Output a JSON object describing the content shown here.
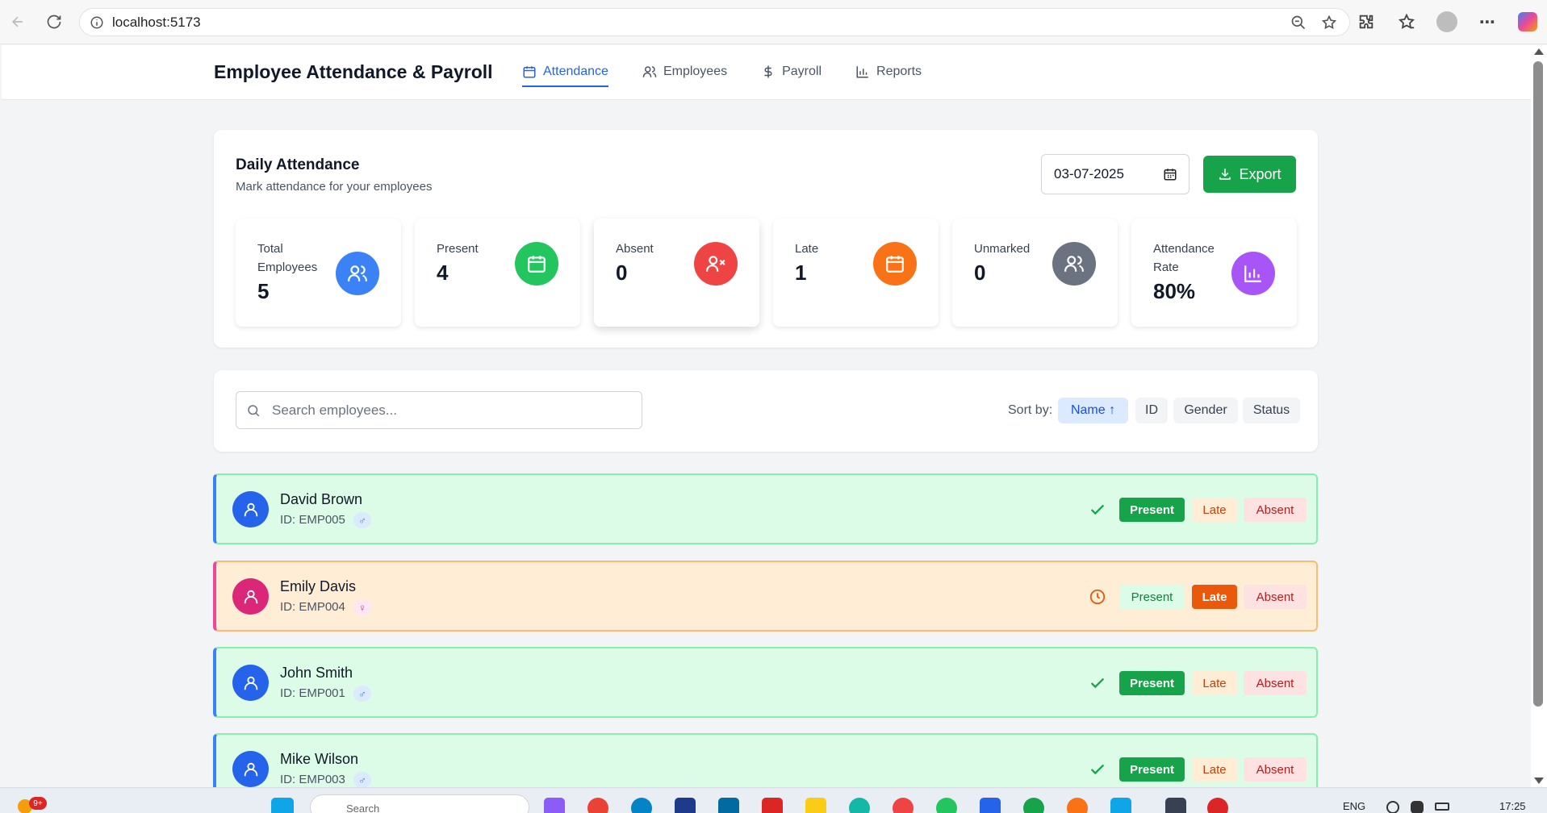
{
  "browser": {
    "url": "localhost:5173"
  },
  "header": {
    "title": "Employee Attendance & Payroll",
    "tabs": [
      {
        "label": "Attendance",
        "icon": "calendar-icon",
        "active": true
      },
      {
        "label": "Employees",
        "icon": "users-icon",
        "active": false
      },
      {
        "label": "Payroll",
        "icon": "dollar-icon",
        "active": false
      },
      {
        "label": "Reports",
        "icon": "bar-chart-icon",
        "active": false
      }
    ]
  },
  "attendance": {
    "title": "Daily Attendance",
    "subtitle": "Mark attendance for your employees",
    "date": "03-07-2025",
    "export_label": "Export"
  },
  "stats": [
    {
      "label": "Total Employees",
      "value": "5",
      "icon": "users-icon",
      "color": "#3b82f6"
    },
    {
      "label": "Present",
      "value": "4",
      "icon": "calendar-icon",
      "color": "#22c55e"
    },
    {
      "label": "Absent",
      "value": "0",
      "icon": "user-x-icon",
      "color": "#ef4444"
    },
    {
      "label": "Late",
      "value": "1",
      "icon": "calendar-icon",
      "color": "#f97316"
    },
    {
      "label": "Unmarked",
      "value": "0",
      "icon": "users-icon",
      "color": "#6b7280"
    },
    {
      "label": "Attendance Rate",
      "value": "80%",
      "icon": "bar-chart-icon",
      "color": "#a855f7"
    }
  ],
  "search": {
    "placeholder": "Search employees...",
    "sort_label": "Sort by:",
    "sort_options": [
      {
        "label": "Name ↑",
        "active": true
      },
      {
        "label": "ID",
        "active": false
      },
      {
        "label": "Gender",
        "active": false
      },
      {
        "label": "Status",
        "active": false
      }
    ]
  },
  "employees": [
    {
      "name": "David Brown",
      "id": "ID: EMP005",
      "gender": "male",
      "gender_symbol": "♂",
      "status": "present",
      "avatar_color": "#2563eb"
    },
    {
      "name": "Emily Davis",
      "id": "ID: EMP004",
      "gender": "female",
      "gender_symbol": "♀",
      "status": "late",
      "avatar_color": "#db2777"
    },
    {
      "name": "John Smith",
      "id": "ID: EMP001",
      "gender": "male",
      "gender_symbol": "♂",
      "status": "present",
      "avatar_color": "#2563eb"
    },
    {
      "name": "Mike Wilson",
      "id": "ID: EMP003",
      "gender": "male",
      "gender_symbol": "♂",
      "status": "present",
      "avatar_color": "#2563eb"
    }
  ],
  "status_labels": {
    "present": "Present",
    "late": "Late",
    "absent": "Absent"
  },
  "taskbar": {
    "notification_badge": "9+",
    "search_text": "Search",
    "language": "ENG",
    "time": "17:25"
  }
}
